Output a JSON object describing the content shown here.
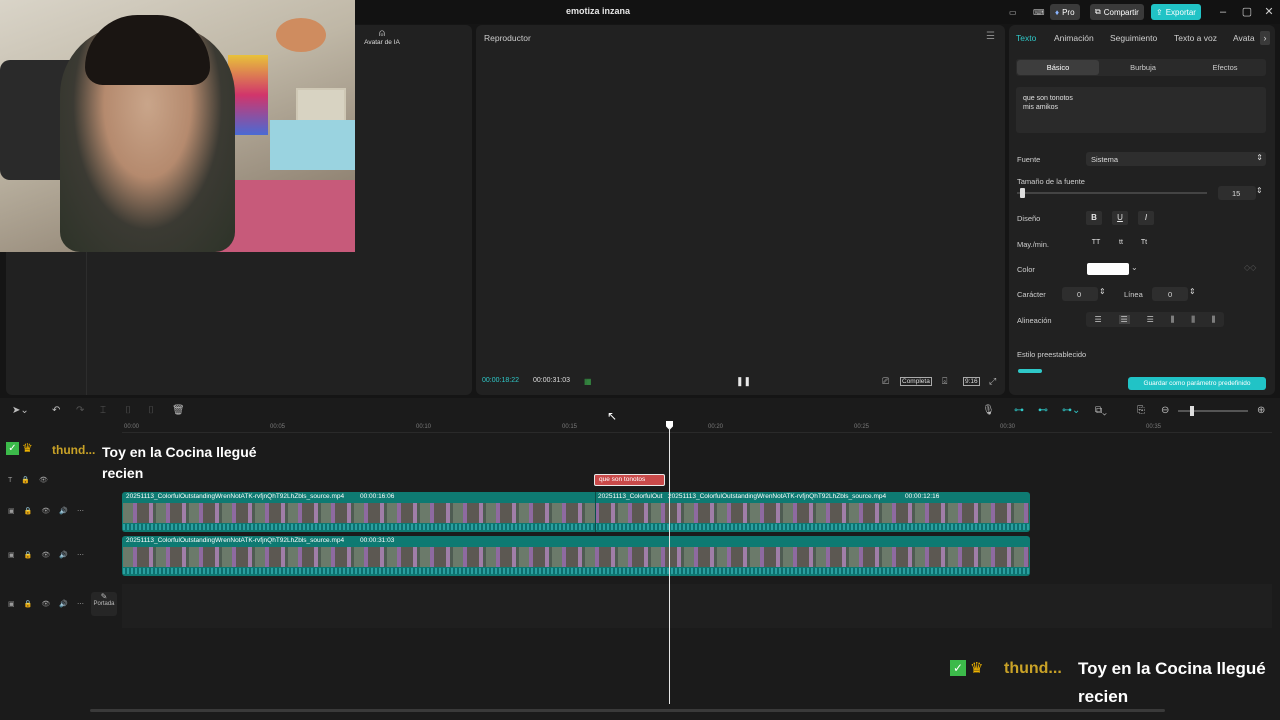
{
  "window": {
    "title": "emotiza inzana",
    "pro_label": "Pro",
    "share_label": "Compartir",
    "export_label": "Exportar"
  },
  "left_panel": {
    "ai_avatar_label": "Avatar de IA"
  },
  "player": {
    "title": "Reproductor",
    "current_time": "00:00:18:22",
    "total_time": "00:00:31:03",
    "complete_label": "Completa",
    "ratio_label": "9:16"
  },
  "properties": {
    "tabs": [
      "Texto",
      "Animación",
      "Seguimiento",
      "Texto a voz",
      "Avata"
    ],
    "subtabs": [
      "Básico",
      "Burbuja",
      "Efectos"
    ],
    "text_content": "que son tonotos\nmis amikos",
    "font_label": "Fuente",
    "font_value": "Sistema",
    "font_size_label": "Tamaño de la fuente",
    "font_size_value": "15",
    "design_label": "Diseño",
    "case_label": "May./min.",
    "case_options": [
      "TT",
      "tt",
      "Tt"
    ],
    "color_label": "Color",
    "color_value": "#ffffff",
    "char_label": "Carácter",
    "char_value": "0",
    "line_label": "Línea",
    "line_value": "0",
    "align_label": "Alineación",
    "preset_label": "Estilo preestablecido",
    "save_preset_label": "Guardar como parámetro predefinido"
  },
  "timeline": {
    "ruler": [
      "00:00",
      "00:05",
      "00:10",
      "00:15",
      "00:20",
      "00:25",
      "00:30",
      "00:35"
    ],
    "text_clip": "que son tonotos",
    "clip_a_name": "20251113_ColorfulOutstandingWrenNotATK-rvfjnQhT92LhZbls_source.mp4",
    "clip_a_dur": "00:00:16:06",
    "clip_b_name": "20251113_ColorfulOut",
    "clip_c_name": "20251113_ColorfulOutstandingWrenNotATK-rvfjnQhT92LhZbls_source.mp4",
    "clip_c_dur": "00:00:12:16",
    "clip_d_name": "20251113_ColorfulOutstandingWrenNotATK-rvfjnQhT92LhZbls_source.mp4",
    "clip_d_dur": "00:00:31:03",
    "cover_label": "Portada"
  },
  "overlay": {
    "chat_user": "thund...",
    "chat_message": "Toy en la Cocina llegué recien",
    "chat_message_line1": "Toy en la Cocina llegué",
    "chat_message_line2": "recien"
  },
  "colors": {
    "accent": "#2fc8c8",
    "export": "#21c3c6",
    "text_clip": "#c94a4a",
    "video_track": "#0e7a72"
  }
}
